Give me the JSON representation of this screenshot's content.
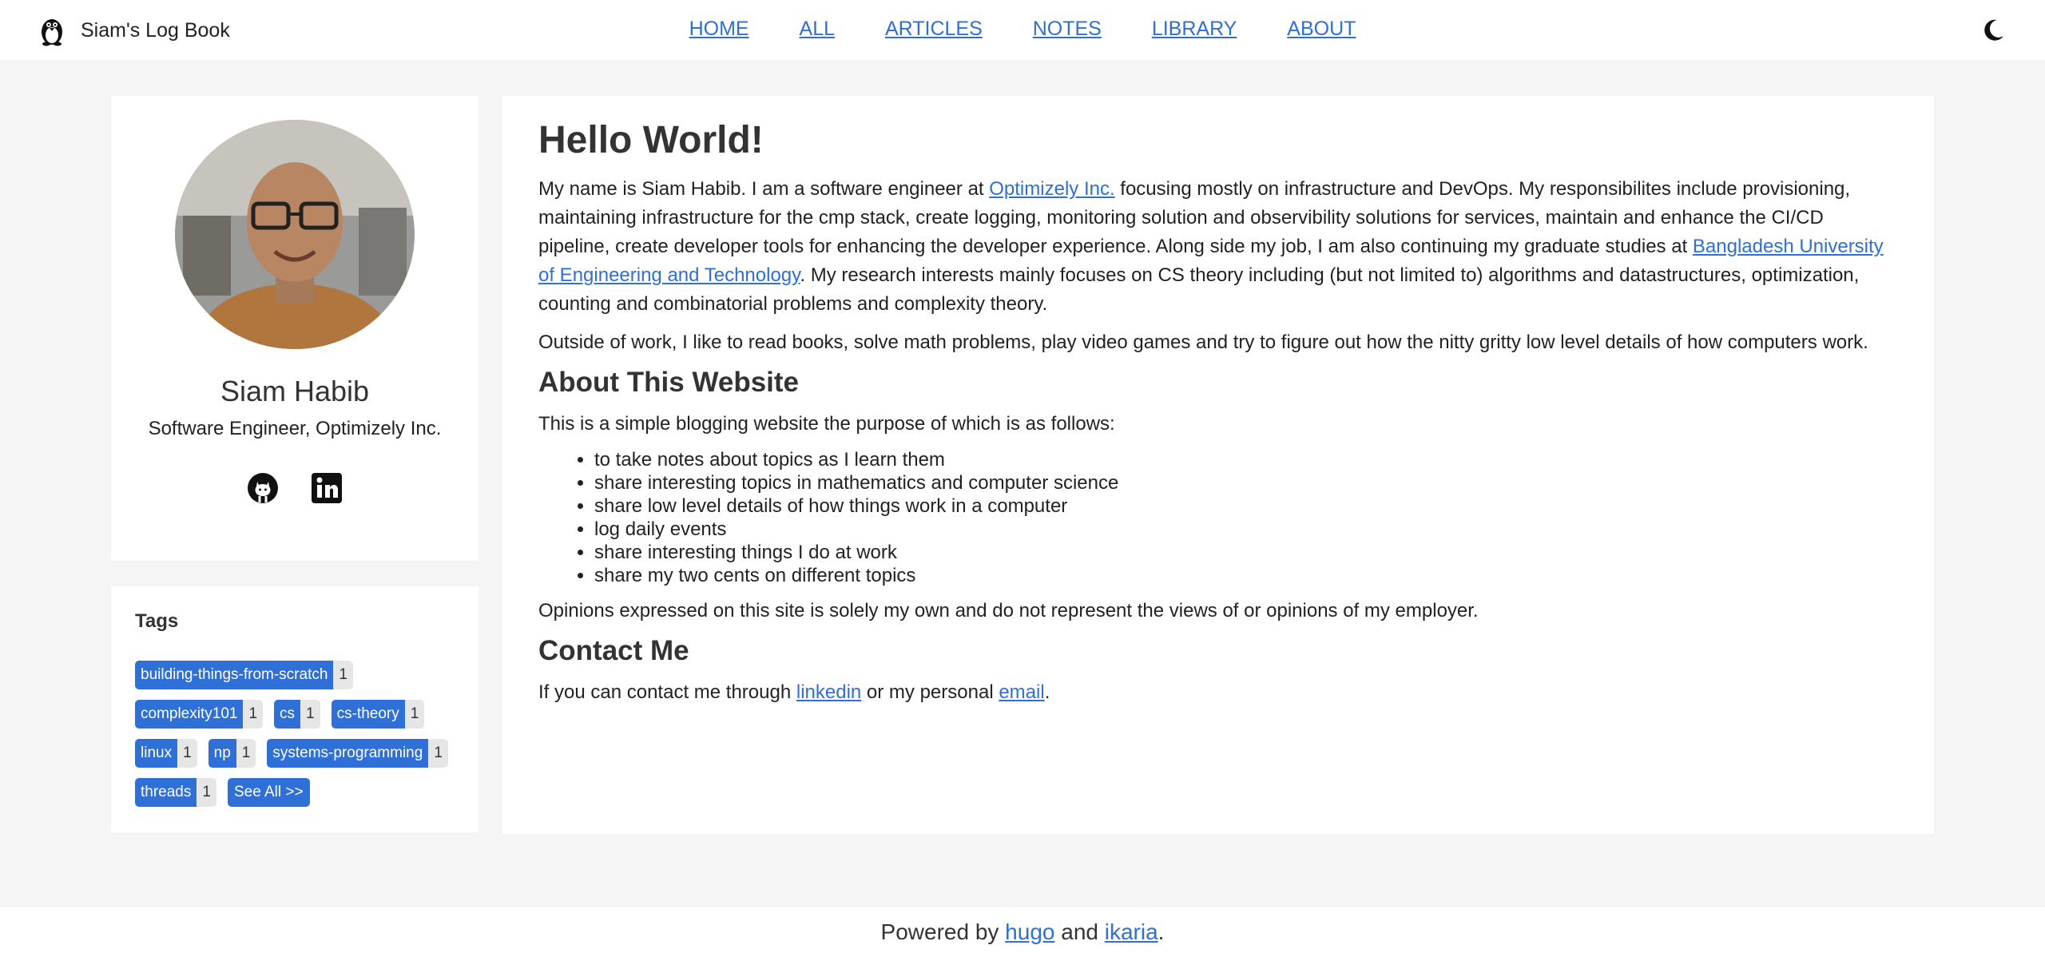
{
  "header": {
    "site_title": "Siam's Log Book",
    "logo_icon": "penguin-icon",
    "nav": [
      "HOME",
      "ALL",
      "ARTICLES",
      "NOTES",
      "LIBRARY",
      "ABOUT"
    ],
    "theme_icon": "moon-icon"
  },
  "profile": {
    "name": "Siam Habib",
    "role": "Software Engineer, Optimizely Inc.",
    "social_icons": [
      "github-icon",
      "linkedin-icon"
    ]
  },
  "tags": {
    "title": "Tags",
    "items": [
      {
        "name": "building-things-from-scratch",
        "count": "1"
      },
      {
        "name": "complexity101",
        "count": "1"
      },
      {
        "name": "cs",
        "count": "1"
      },
      {
        "name": "cs-theory",
        "count": "1"
      },
      {
        "name": "linux",
        "count": "1"
      },
      {
        "name": "np",
        "count": "1"
      },
      {
        "name": "systems-programming",
        "count": "1"
      },
      {
        "name": "threads",
        "count": "1"
      }
    ],
    "see_all": "See All >>"
  },
  "content": {
    "title": "Hello World!",
    "p1": {
      "a": "My name is Siam Habib. I am a software engineer at ",
      "link1": "Optimizely Inc.",
      "b": " focusing mostly on infrastructure and DevOps. My responsibilites include provisioning, maintaining infrastructure for the cmp stack, create logging, monitoring solution and observibility solutions for services, maintain and enhance the CI/CD pipeline, create developer tools for enhancing the developer experience. Along side my job, I am also continuing my graduate studies at ",
      "link2": "Bangladesh University of Engineering and Technology",
      "c": ". My research interests mainly focuses on CS theory including (but not limited to) algorithms and datastructures, optimization, counting and combinatorial problems and complexity theory."
    },
    "p2": "Outside of work, I like to read books, solve math problems, play video games and try to figure out how the nitty gritty low level details of how computers work.",
    "h_about": "About This Website",
    "about_intro": "This is a simple blogging website the purpose of which is as follows:",
    "about_list": [
      "to take notes about topics as I learn them",
      "share interesting topics in mathematics and computer science",
      "share low level details of how things work in a computer",
      "log daily events",
      "share interesting things I do at work",
      "share my two cents on different topics"
    ],
    "opinions": "Opinions expressed on this site is solely my own and do not represent the views of or opinions of my employer.",
    "h_contact": "Contact Me",
    "contact": {
      "a": "If you can contact me through ",
      "link1": "linkedin",
      "b": " or my personal ",
      "link2": "email",
      "c": "."
    }
  },
  "footer": {
    "a": "Powered by ",
    "link1": "hugo",
    "b": " and ",
    "link2": "ikaria",
    "c": "."
  }
}
